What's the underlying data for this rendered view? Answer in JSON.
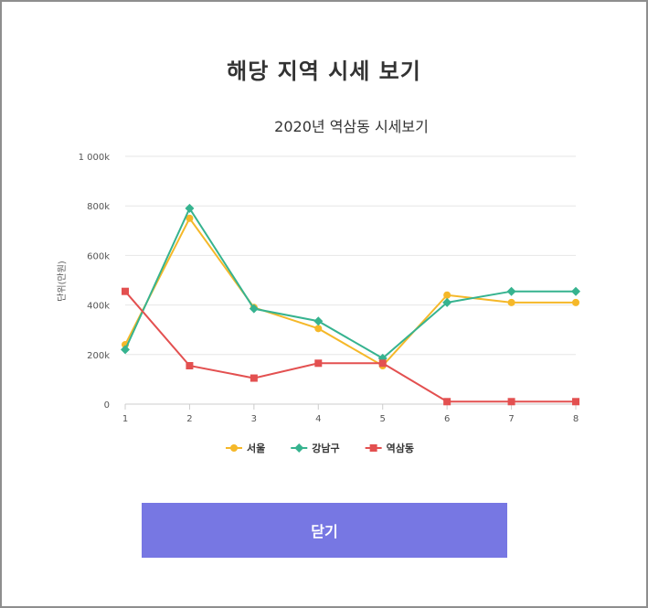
{
  "modal": {
    "title": "해당 지역 시세 보기",
    "close_label": "닫기"
  },
  "colors": {
    "seoul": "#f5b829",
    "gangnam": "#36b38f",
    "yeoksam": "#e35050",
    "button": "#7777e3"
  },
  "chart_data": {
    "type": "line",
    "title": "2020년 역삼동 시세보기",
    "xlabel": "",
    "ylabel": "단위(만원)",
    "x": [
      1,
      2,
      3,
      4,
      5,
      6,
      7,
      8
    ],
    "ylim": [
      0,
      1000000
    ],
    "yticks": [
      0,
      200000,
      400000,
      600000,
      800000,
      1000000
    ],
    "ytick_labels": [
      "0",
      "200k",
      "400k",
      "600k",
      "800k",
      "1 000k"
    ],
    "grid": true,
    "legend": "bottom-center",
    "series": [
      {
        "name": "서울",
        "color": "#f5b829",
        "marker": "circle",
        "values": [
          240000,
          750000,
          390000,
          305000,
          155000,
          440000,
          410000,
          410000
        ]
      },
      {
        "name": "강남구",
        "color": "#36b38f",
        "marker": "diamond",
        "values": [
          220000,
          790000,
          385000,
          335000,
          185000,
          410000,
          455000,
          455000
        ]
      },
      {
        "name": "역삼동",
        "color": "#e35050",
        "marker": "square",
        "values": [
          455000,
          155000,
          105000,
          165000,
          165000,
          10000,
          10000,
          10000
        ]
      }
    ]
  }
}
